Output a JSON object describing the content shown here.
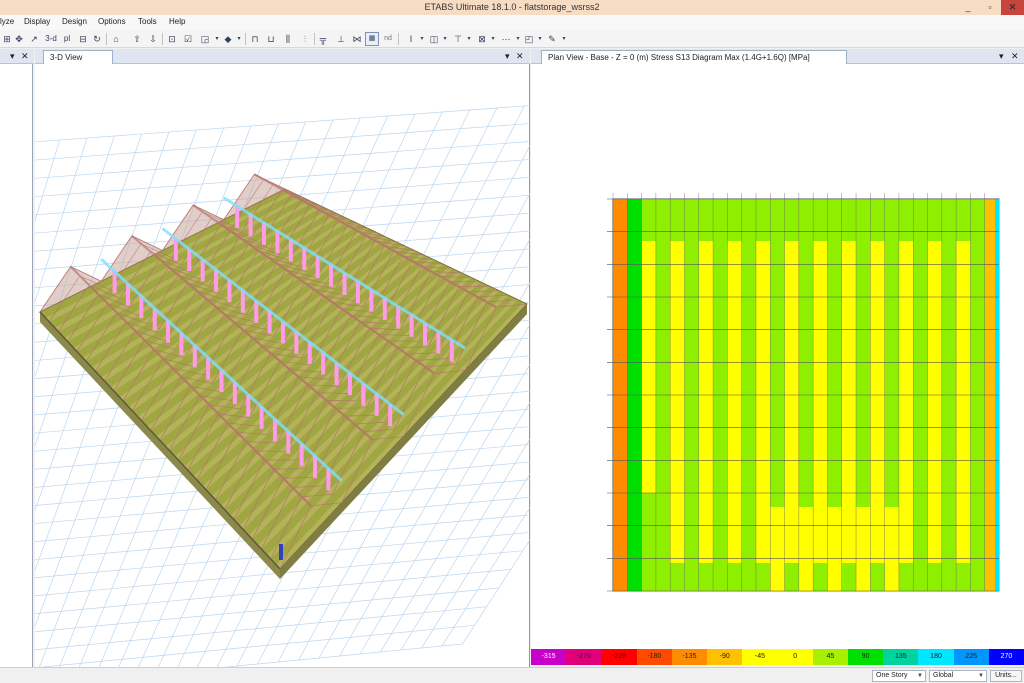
{
  "window": {
    "title": "ETABS Ultimate 18.1.0 - flatstorage_wsrss2",
    "minimize_glyph": "_",
    "maximize_glyph": "▫",
    "close_glyph": "✕"
  },
  "menu": [
    "lyze",
    "Display",
    "Design",
    "Options",
    "Tools",
    "Help"
  ],
  "toolbar": {
    "view_3d_label": "3-d",
    "plan_label": "pl",
    "nd_label": "nd",
    "icons": [
      "rubberband-zoom-icon",
      "pan-icon",
      "3d-view-icon",
      "plan-view-icon",
      "elevation-view-icon",
      "rotate-icon",
      "perspective-icon",
      "move-up-icon",
      "move-down-icon",
      "select-icon",
      "checkbox-icon",
      "object-shrink-icon",
      "extrude-icon",
      "frame-icon",
      "shell-icon",
      "wall-icon",
      "joint-icon",
      "draw-frame-icon",
      "draw-beam-icon",
      "draw-brace-icon",
      "draw-area-icon",
      "draw-wall-icon",
      "section-icon",
      "assign-icon",
      "load-icon",
      "display-icon",
      "grid-icon",
      "design-icon",
      "pencil-icon"
    ]
  },
  "panes": {
    "left_pin_glyph": "▾",
    "left_close_glyph": "✕",
    "view3d": {
      "tab_label": "3-D View",
      "pin_glyph": "▾",
      "close_glyph": "✕"
    },
    "plan": {
      "tab_label": "Plan View - Base - Z = 0 (m)    Stress S13 Diagram  Max    (1.4G+1.6Q)  [MPa]",
      "pin_glyph": "▾",
      "close_glyph": "✕"
    }
  },
  "legend": {
    "values": [
      "-315",
      "-270",
      "-225",
      "-180",
      "-135",
      "-90",
      "-45",
      "0",
      "45",
      "90",
      "135",
      "180",
      "225",
      "270"
    ],
    "colors": [
      "#c800c8",
      "#e0007a",
      "#ff0000",
      "#ff4b00",
      "#ff8c00",
      "#ffc000",
      "#ffff00",
      "#ffff00",
      "#a8f000",
      "#00e000",
      "#00d2a0",
      "#00e6ff",
      "#0096ff",
      "#0000ff"
    ]
  },
  "statusbar": {
    "story_mode": "One Story",
    "coord_system": "Global",
    "units_button": "Units..."
  },
  "colors": {
    "titlebar": "#f7dcc4",
    "close_button": "#c7453d",
    "grid_line": "#bcd6ee",
    "slab": "#9aa338",
    "roof_truss": "#b7776b",
    "column": "#ff9be8",
    "ridge": "#7ee0ff"
  }
}
